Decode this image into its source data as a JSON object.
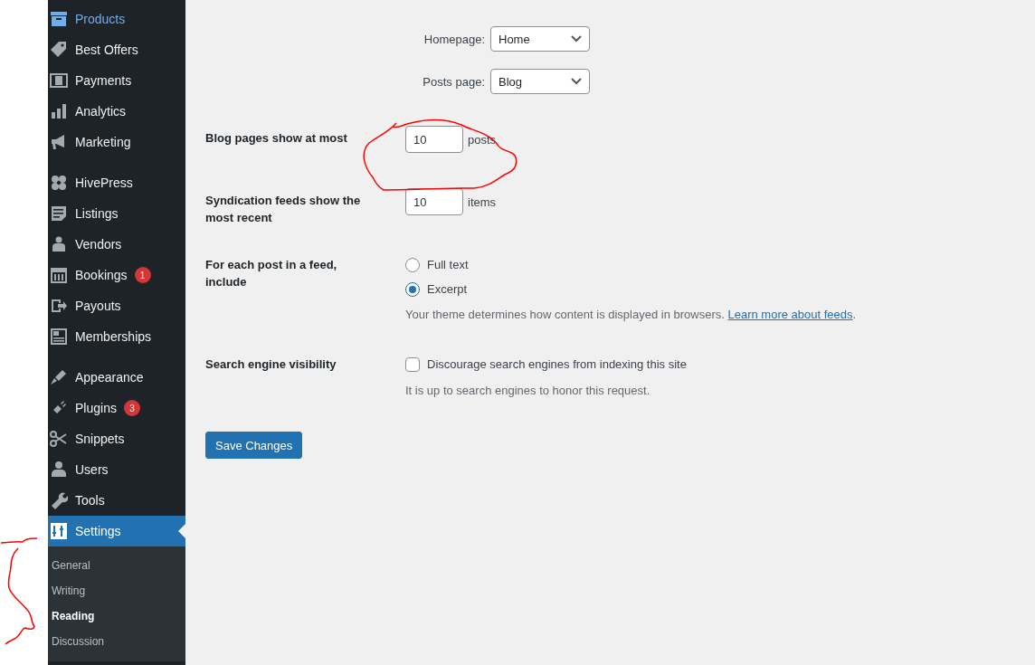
{
  "sidebar": {
    "groups": [
      {
        "items": [
          {
            "label": "Products",
            "hovered": true,
            "selected": false
          },
          {
            "label": "Best Offers",
            "hovered": false,
            "selected": false
          },
          {
            "label": "Payments",
            "hovered": false,
            "selected": false
          },
          {
            "label": "Analytics",
            "hovered": false,
            "selected": false
          },
          {
            "label": "Marketing",
            "hovered": false,
            "selected": false
          }
        ]
      },
      {
        "items": [
          {
            "label": "HivePress",
            "hovered": false,
            "selected": false
          },
          {
            "label": "Listings",
            "hovered": false,
            "selected": false
          },
          {
            "label": "Vendors",
            "hovered": false,
            "selected": false
          },
          {
            "label": "Bookings",
            "badge": "1",
            "hovered": false,
            "selected": false
          },
          {
            "label": "Payouts",
            "hovered": false,
            "selected": false
          },
          {
            "label": "Memberships",
            "hovered": false,
            "selected": false
          }
        ]
      },
      {
        "items": [
          {
            "label": "Appearance",
            "hovered": false,
            "selected": false
          },
          {
            "label": "Plugins",
            "badge": "3",
            "hovered": false,
            "selected": false
          },
          {
            "label": "Snippets",
            "hovered": false,
            "selected": false
          },
          {
            "label": "Users",
            "hovered": false,
            "selected": false
          },
          {
            "label": "Tools",
            "hovered": false,
            "selected": false
          },
          {
            "label": "Settings",
            "hovered": false,
            "selected": true,
            "submenu": [
              {
                "label": "General",
                "selected": false
              },
              {
                "label": "Writing",
                "selected": false
              },
              {
                "label": "Reading",
                "selected": true
              },
              {
                "label": "Discussion",
                "selected": false
              }
            ]
          }
        ]
      }
    ]
  },
  "homepage_selects": [
    {
      "label": "Homepage:",
      "value": "Home"
    },
    {
      "label": "Posts page:",
      "value": "Blog"
    }
  ],
  "blog_pages": {
    "label": "Blog pages show at most",
    "value": "10",
    "unit": "posts"
  },
  "syndication": {
    "label": "Syndication feeds show the most recent",
    "value": "10",
    "unit": "items"
  },
  "feed_include": {
    "label": "For each post in a feed, include",
    "options": [
      {
        "label": "Full text",
        "selected": false
      },
      {
        "label": "Excerpt",
        "selected": true
      }
    ],
    "description": "Your theme determines how content is displayed in browsers.",
    "link": "Learn more about feeds",
    "after_link": "."
  },
  "search_visibility": {
    "label": "Search engine visibility",
    "checkbox": {
      "label": "Discourage search engines from indexing this site",
      "checked": false
    },
    "description": "It is up to search engines to honor this request."
  },
  "save_button": "Save Changes"
}
